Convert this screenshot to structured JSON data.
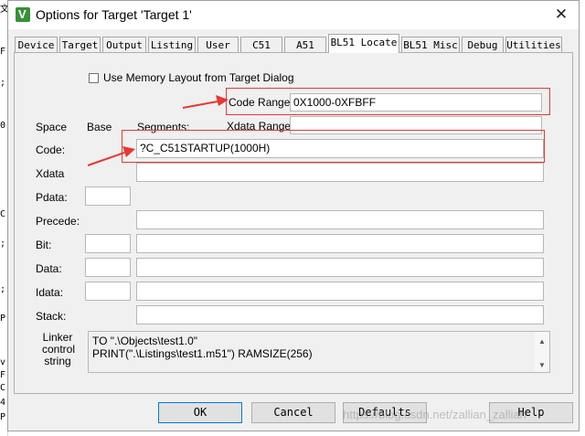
{
  "background_editor_chars": [
    "文",
    "F",
    ";",
    "0",
    "C",
    ";",
    ";",
    "P",
    "v",
    "F",
    "C",
    "4",
    "P"
  ],
  "window": {
    "title": "Options for Target 'Target 1'",
    "close_glyph": "✕",
    "icon_glyph": "V"
  },
  "tabs": [
    {
      "label": "Device",
      "active": false
    },
    {
      "label": "Target",
      "active": false
    },
    {
      "label": "Output",
      "active": false
    },
    {
      "label": "Listing",
      "active": false
    },
    {
      "label": "User",
      "active": false
    },
    {
      "label": "C51",
      "active": false
    },
    {
      "label": "A51",
      "active": false
    },
    {
      "label": "BL51 Locate",
      "active": true
    },
    {
      "label": "BL51 Misc",
      "active": false
    },
    {
      "label": "Debug",
      "active": false
    },
    {
      "label": "Utilities",
      "active": false
    }
  ],
  "locate": {
    "use_memory_layout": {
      "label": "Use Memory Layout from Target Dialog",
      "checked": false
    },
    "code_range": {
      "label": "Code Range:",
      "value": "0X1000-0XFBFF"
    },
    "xdata_range": {
      "label": "Xdata Range:",
      "value": ""
    },
    "headers": {
      "space": "Space",
      "base": "Base",
      "segments": "Segments:"
    },
    "rows": {
      "code": {
        "label": "Code:",
        "segments": "?C_C51STARTUP(1000H)"
      },
      "xdata": {
        "label": "Xdata",
        "segments": ""
      },
      "pdata": {
        "label": "Pdata:",
        "base": ""
      },
      "precede": {
        "label": "Precede:",
        "segments": ""
      },
      "bit": {
        "label": "Bit:",
        "base": "",
        "segments": ""
      },
      "data": {
        "label": "Data:",
        "base": "",
        "segments": ""
      },
      "idata": {
        "label": "Idata:",
        "base": "",
        "segments": ""
      },
      "stack": {
        "label": "Stack:",
        "segments": ""
      }
    },
    "linker_control": {
      "label_line1": "Linker",
      "label_line2": "control",
      "label_line3": "string",
      "line1": "TO \".\\Objects\\test1.0\"",
      "line2": "PRINT(\".\\Listings\\test1.m51\") RAMSIZE(256)",
      "scroll_up_glyph": "▲",
      "scroll_down_glyph": "▼"
    }
  },
  "buttons": {
    "ok": "OK",
    "cancel": "Cancel",
    "defaults": "Defaults",
    "help": "Help"
  },
  "annotation_color": "#e53935",
  "watermark": "https://blog.csdn.net/zallian_zallian"
}
